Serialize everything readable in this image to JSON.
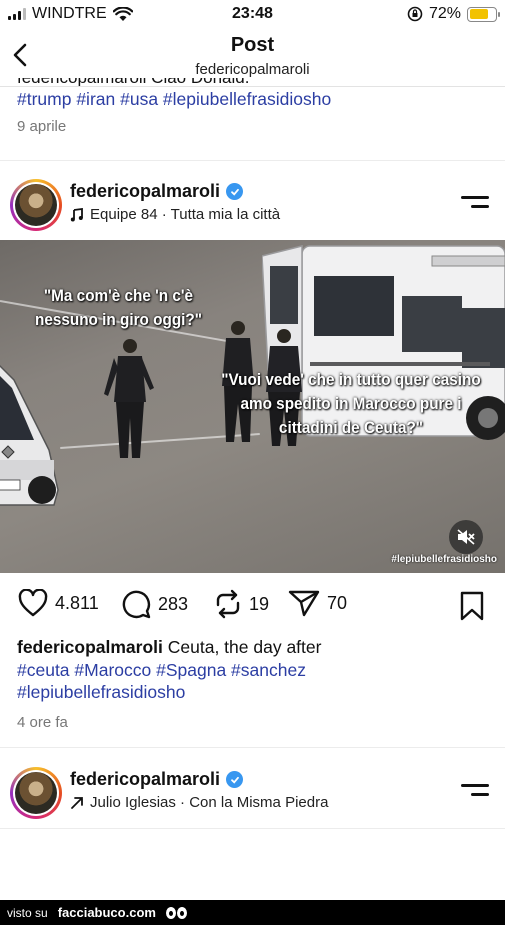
{
  "status_bar": {
    "carrier": "WINDTRE",
    "time": "23:48",
    "battery": "72%",
    "battery_level": 0.72
  },
  "nav": {
    "title": "Post",
    "subtitle": "federicopalmaroli"
  },
  "previous_post": {
    "cut_text": "federicopalmaroli Ciao Donald.",
    "hashtags": "#trump #iran #usa #lepiubellefrasidiosho",
    "date": "9 aprile"
  },
  "post": {
    "username": "federicopalmaroli",
    "music": "Equipe 84 · Tutta mia la città",
    "media": {
      "caption_top": "\"Ma com'è che 'n c'è nessuno in giro oggi?\"",
      "caption_bottom": "\"Vuoi vede' che in tutto quer casino amo spedito in Marocco pure i cittadini de Ceuta?\"",
      "watermark": "#lepiubellefrasidiosho"
    },
    "likes": "4.811",
    "comments": "283",
    "reposts": "19",
    "shares": "70",
    "caption_user": "federicopalmaroli",
    "caption_text": " Ceuta, the day after",
    "hashtags_line1": "#ceuta #Marocco #Spagna #sanchez",
    "hashtags_line2": "#lepiubellefrasidiosho",
    "date": "4 ore fa"
  },
  "next_post": {
    "username": "federicopalmaroli",
    "music": "Julio Iglesias · Con la Misma Piedra"
  },
  "footer": {
    "prefix": "visto su",
    "brand": "facciabuco.com"
  },
  "colors": {
    "hashtag": "#2c3ea3",
    "verified": "#3897f0",
    "battery": "#f2c200"
  }
}
